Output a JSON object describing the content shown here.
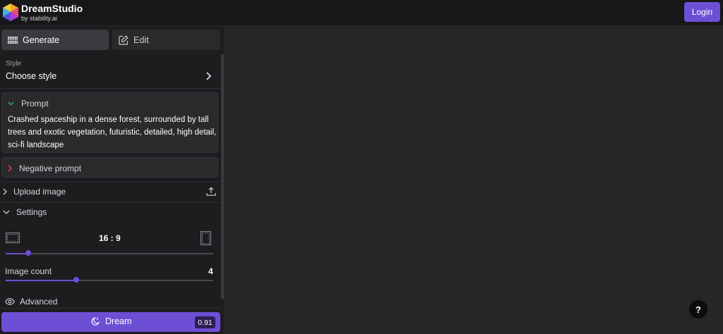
{
  "header": {
    "brand_name": "DreamStudio",
    "brand_sub": "by stability.ai",
    "login_label": "Login",
    "logo_icon": "hexagon-logo-icon"
  },
  "tabs": [
    {
      "label": "Generate",
      "icon": "grid-icon",
      "active": true
    },
    {
      "label": "Edit",
      "icon": "edit-icon",
      "active": false
    }
  ],
  "style": {
    "label": "Style",
    "value": "Choose style"
  },
  "prompt": {
    "label": "Prompt",
    "text": "Crashed spaceship in a dense forest, surrounded by tall trees and exotic vegetation, futuristic, detailed, high detail, sci-fi landscape"
  },
  "negative_prompt": {
    "label": "Negative prompt"
  },
  "upload": {
    "label": "Upload image"
  },
  "settings": {
    "label": "Settings",
    "aspect_ratio": "16 : 9",
    "aspect_slider_fraction": 0.11,
    "image_count_label": "Image count",
    "image_count": "4",
    "image_count_fraction": 0.34,
    "advanced_label": "Advanced"
  },
  "dream": {
    "label": "Dream",
    "cost": "0.91"
  },
  "help": {
    "label": "?"
  },
  "colors": {
    "accent": "#6d4fd6",
    "background": "#262527",
    "panel": "#1d1c1f",
    "prompt_chevron": "#22c55e",
    "negative_chevron": "#ef4444"
  }
}
